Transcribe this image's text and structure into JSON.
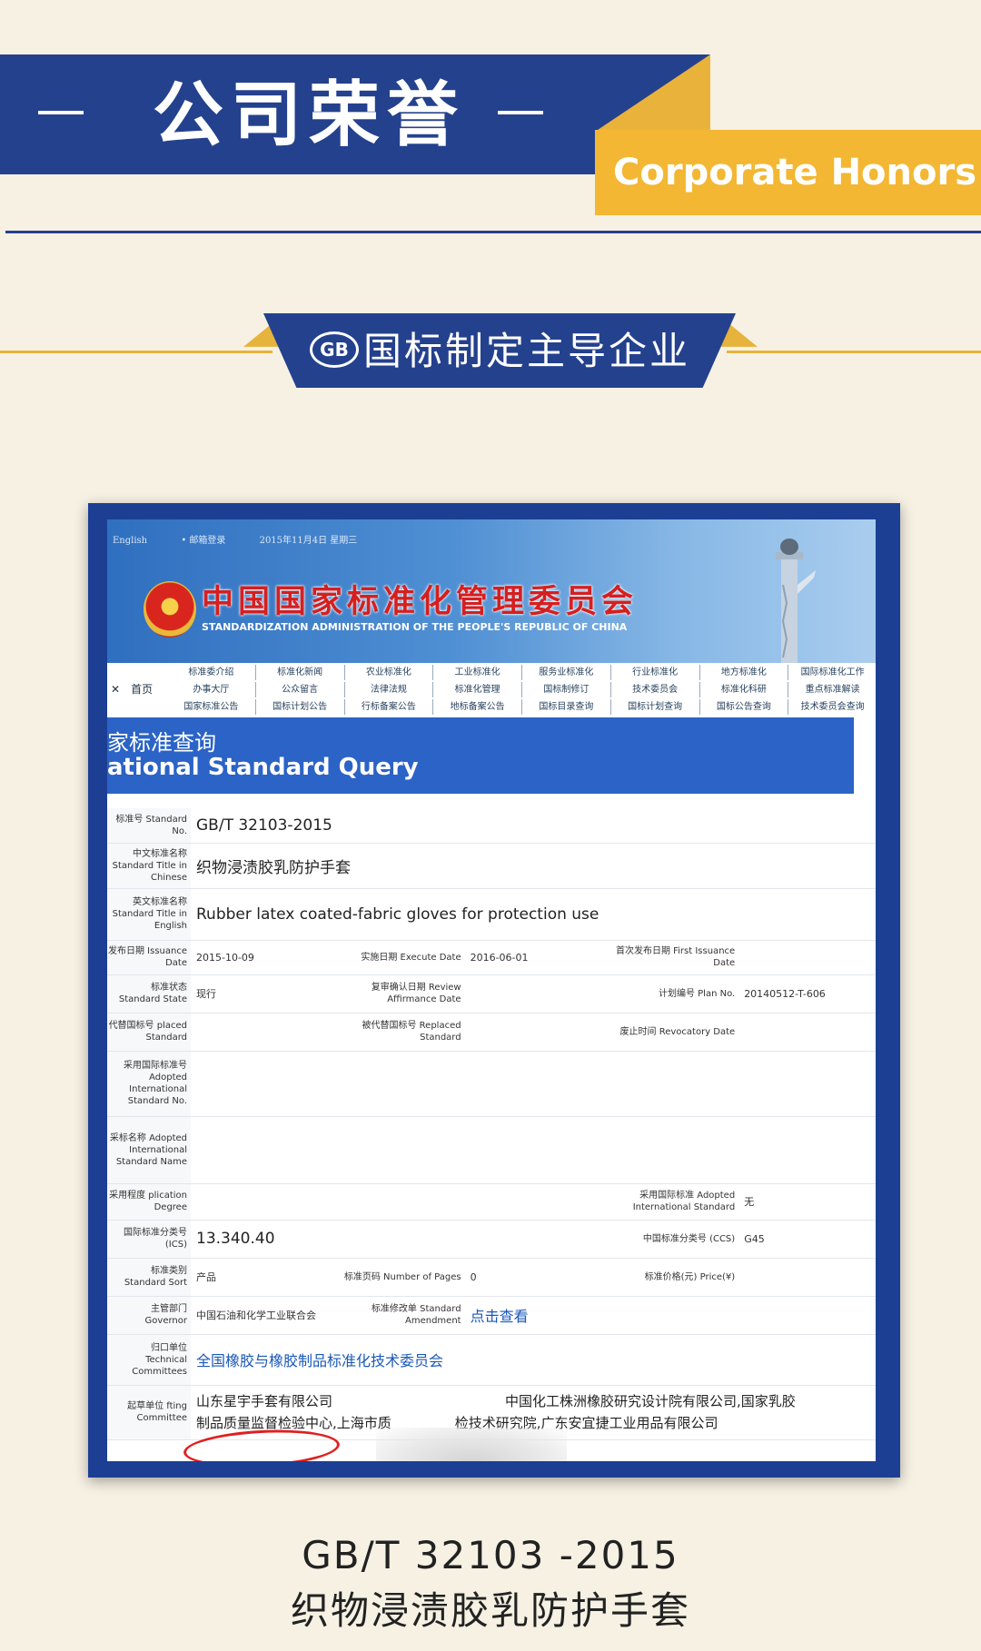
{
  "banner": {
    "title": "公司荣誉",
    "subtitle_en": "Corporate Honors"
  },
  "section": {
    "badge": "GB",
    "title": "国标制定主导企业"
  },
  "screenshot": {
    "topbar": [
      "English",
      "• 邮箱登录",
      "2015年11月4日 星期三"
    ],
    "site_title": "中国国家标准化管理委员会",
    "site_subtitle": "STANDARDIZATION ADMINISTRATION OF THE PEOPLE'S REPUBLIC OF CHINA",
    "nav_home": "首页",
    "nav_items": [
      "标准委介绍",
      "标准化新闻",
      "农业标准化",
      "工业标准化",
      "服务业标准化",
      "行业标准化",
      "地方标准化",
      "国际标准化工作",
      "办事大厅",
      "公众留言",
      "法律法规",
      "标准化管理",
      "国标制修订",
      "技术委员会",
      "标准化科研",
      "重点标准解读",
      "国家标准公告",
      "国标计划公告",
      "行标备案公告",
      "地标备案公告",
      "国标目录查询",
      "国标计划查询",
      "国标公告查询",
      "技术委员会查询"
    ],
    "query_title_cn": "家标准查询",
    "query_title_en": "ational Standard Query",
    "fields": {
      "standard_no_label": "标准号 Standard No.",
      "standard_no": "GB/T 32103-2015",
      "title_cn_label": "中文标准名称 Standard Title in Chinese",
      "title_cn": "织物浸渍胶乳防护手套",
      "title_en_label": "英文标准名称 Standard Title in English",
      "title_en": "Rubber latex coated-fabric gloves for protection use",
      "issuance_label": "发布日期 Issuance Date",
      "issuance": "2015-10-09",
      "execute_label": "实施日期 Execute Date",
      "execute": "2016-06-01",
      "first_issuance_label": "首次发布日期 First Issuance Date",
      "state_label": "标准状态 Standard State",
      "state": "现行",
      "review_label": "复审确认日期 Review Affirmance Date",
      "plan_label": "计划编号 Plan No.",
      "plan": "20140512-T-606",
      "replaced_label": "代替国标号 placed Standard",
      "replaced2_label": "被代替国标号 Replaced Standard",
      "revocatory_label": "废止时间 Revocatory Date",
      "adopted_no_label": "采用国际标准号 Adopted International Standard No.",
      "adopted_name_label": "采标名称 Adopted International Standard Name",
      "degree_label": "采用程度 plication Degree",
      "adopted_intl_label": "采用国际标准 Adopted International Standard",
      "adopted_intl": "无",
      "ics_label": "国际标准分类号 (ICS)",
      "ics": "13.340.40",
      "ccs_label": "中国标准分类号 (CCS)",
      "ccs": "G45",
      "sort_label": "标准类别 Standard Sort",
      "sort": "产品",
      "pages_label": "标准页码 Number of Pages",
      "pages": "0",
      "price_label": "标准价格(元) Price(¥)",
      "governor_label": "主管部门 Governor",
      "governor": "中国石油和化学工业联合会",
      "amendment_label": "标准修改单 Standard Amendment",
      "amendment": "点击查看",
      "technical_label": "归口单位 Technical Committees",
      "technical": "全国橡胶与橡胶制品标准化技术委员会",
      "drafting_label": "起草单位 fting Committee",
      "drafting_1": "山东星宇手套有限公司",
      "drafting_2": "中国化工株洲橡胶研究设计院有限公司,国家乳胶",
      "drafting_3": "制品质量监督检验中心,上海市质",
      "drafting_4": "检技术研究院,广东安宜捷工业用品有限公司"
    }
  },
  "caption": {
    "line1": "GB/T 32103 -2015",
    "line2": "织物浸渍胶乳防护手套"
  }
}
